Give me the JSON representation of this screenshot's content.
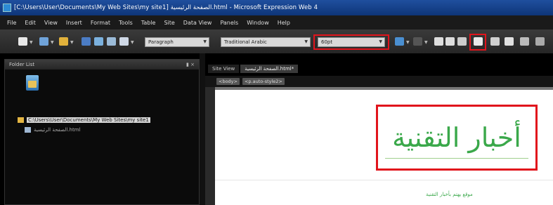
{
  "window": {
    "title": "[C:\\Users\\User\\Documents\\My Web Sites\\my site1] الصفحة الرئيسية.html - Microsoft Expression Web 4"
  },
  "menu": {
    "items": [
      "File",
      "Edit",
      "View",
      "Insert",
      "Format",
      "Tools",
      "Table",
      "Site",
      "Data View",
      "Panels",
      "Window",
      "Help"
    ]
  },
  "toolbar": {
    "style_value": "Paragraph",
    "font_value": "Traditional Arabic",
    "size_value": "60pt"
  },
  "folder_panel": {
    "title": "Folder List",
    "path": "C:\\Users\\User\\Documents\\My Web Sites\\my site1",
    "file": "الصفحة الرئيسية.html"
  },
  "editor": {
    "tabs": [
      "Site View",
      "الصفحة الرئيسية.html*"
    ],
    "breadcrumbs": [
      "<body>",
      "<p.auto-style2>"
    ]
  },
  "page": {
    "heading": "أخبار التقنية",
    "subtitle": "موقع يهتم بأخبار التقنية"
  }
}
